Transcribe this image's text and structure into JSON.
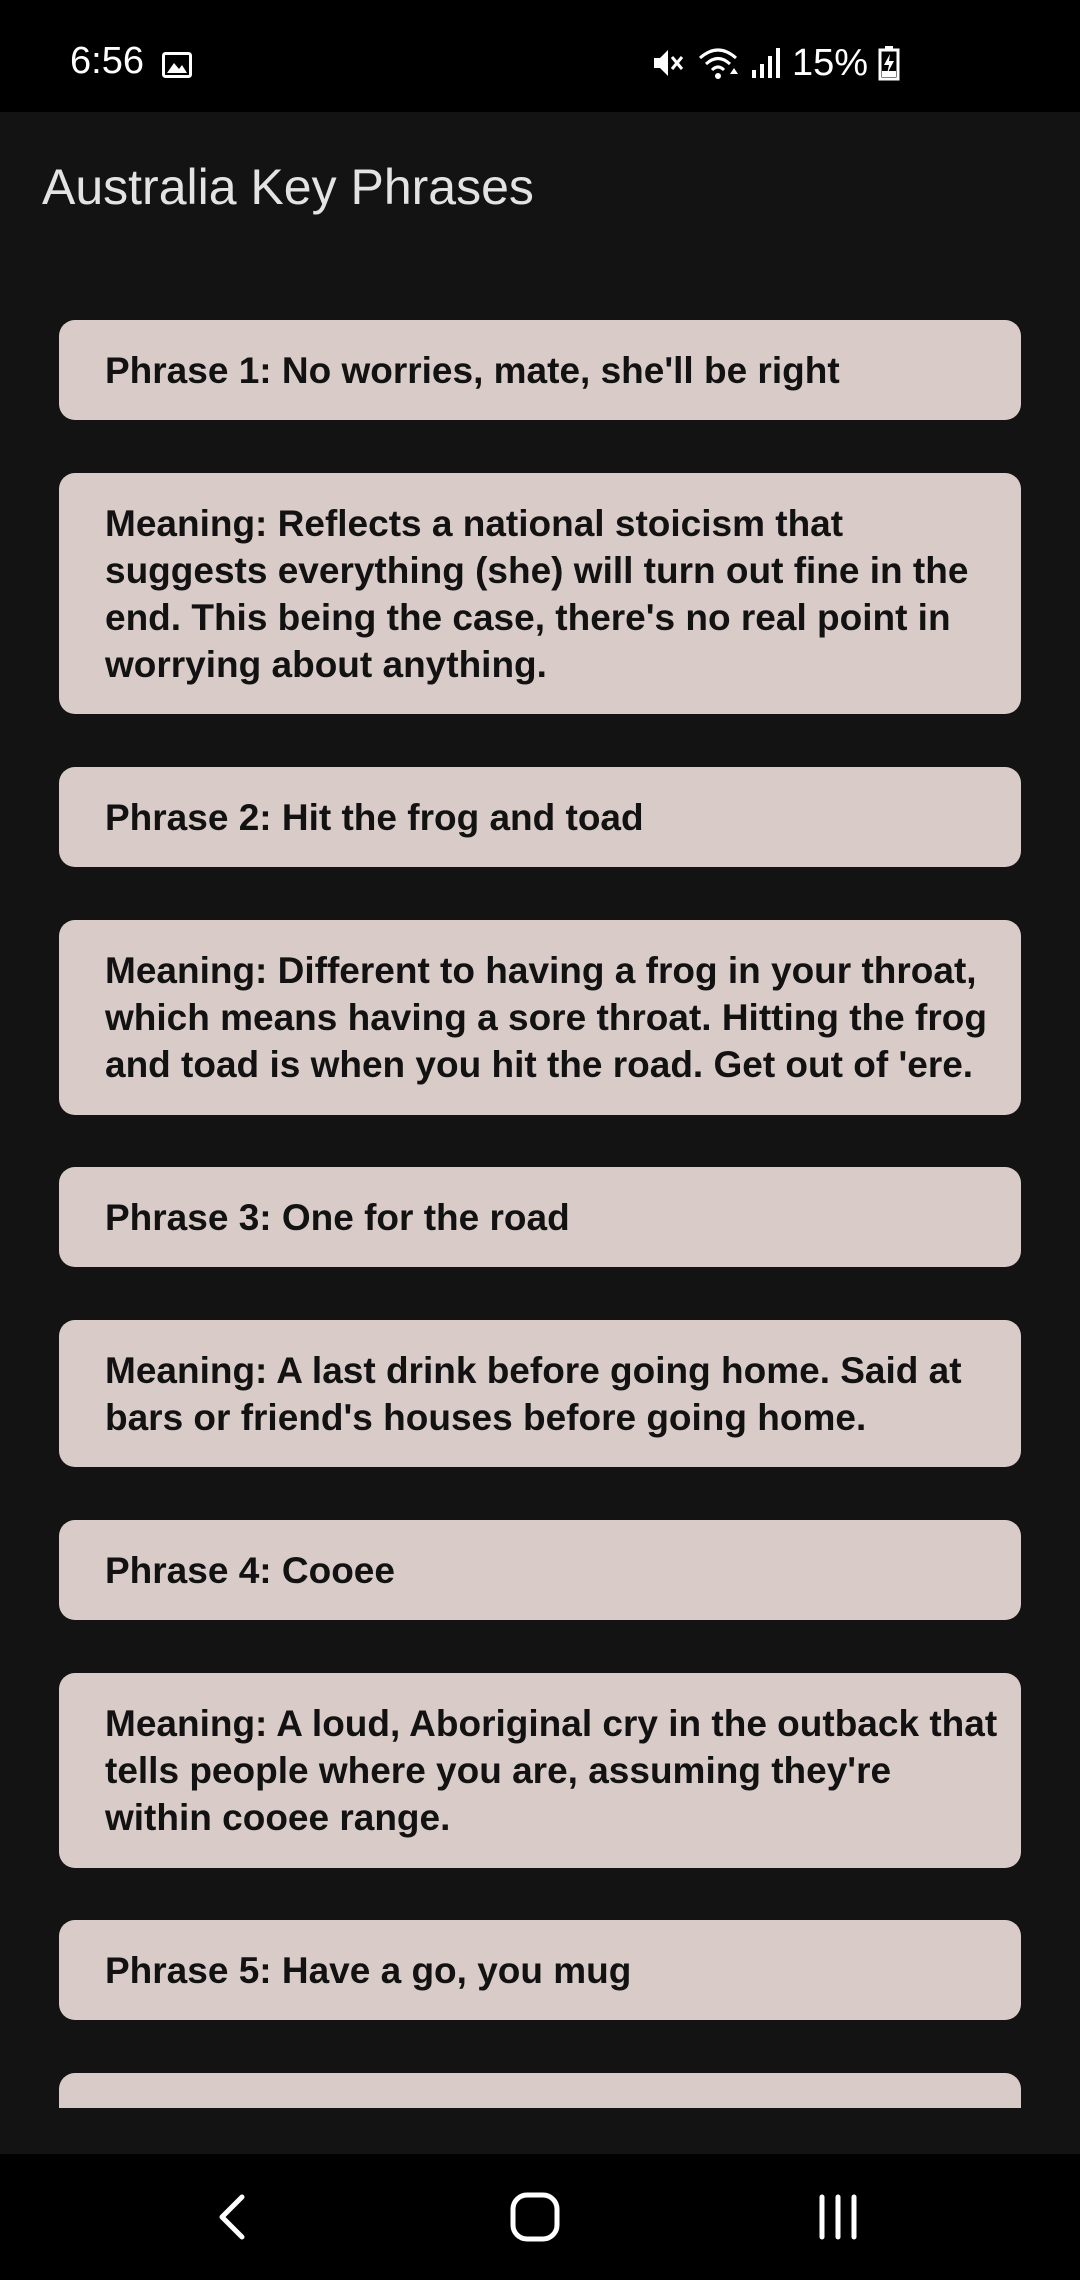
{
  "status_bar": {
    "time": "6:56",
    "battery_percent": "15%",
    "icons": [
      "gallery-icon",
      "mute-icon",
      "wifi-icon",
      "signal-icon",
      "battery-charging-icon"
    ]
  },
  "header": {
    "title": "Australia Key Phrases"
  },
  "cards": [
    "Phrase 1: No worries, mate, she'll be right",
    "Meaning: Reflects a national stoicism that suggests everything (she) will turn out fine in the end. This being the case, there's no real point in worrying about anything.",
    "Phrase 2: Hit the frog and toad",
    "Meaning: Different to having a frog in your throat, which means having a sore throat. Hitting the frog and toad is when you hit the road. Get out of 'ere.",
    "Phrase 3: One for the road",
    "Meaning: A last drink before going home. Said at bars or friend's houses before going home.",
    "Phrase 4: Cooee",
    "Meaning: A loud, Aboriginal cry in the outback that tells people where you are, assuming they're within cooee range.",
    "Phrase 5: Have a go, you mug",
    ""
  ],
  "nav_bar": {
    "icons": [
      "back-icon",
      "home-icon",
      "recent-apps-icon"
    ]
  },
  "colors": {
    "background": "#131313",
    "card": "#d8cbc8",
    "card_text": "#121212",
    "title_text": "#e3e3e3"
  }
}
